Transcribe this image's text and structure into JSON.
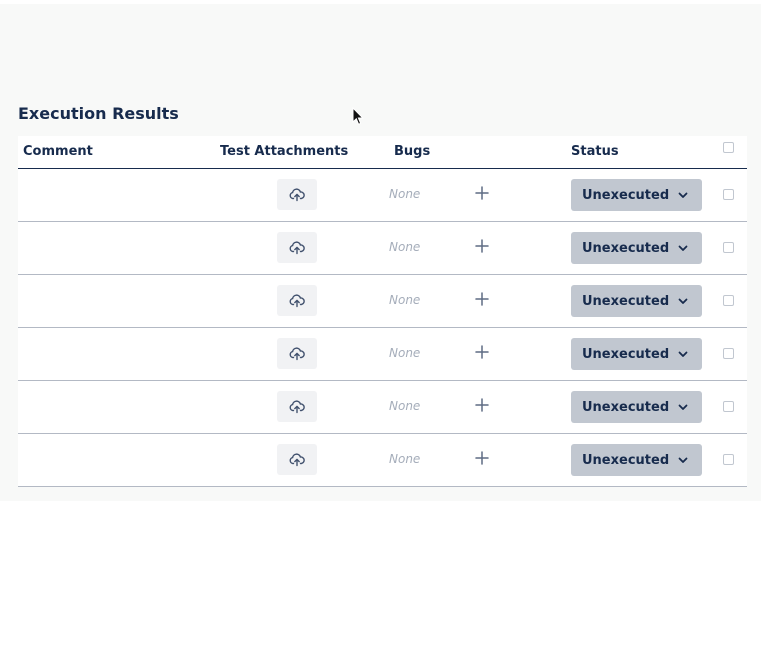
{
  "section": {
    "title": "Execution Results"
  },
  "table": {
    "headers": {
      "comment": "Comment",
      "attachments": "Test Attachments",
      "bugs": "Bugs",
      "status": "Status"
    },
    "rows": [
      {
        "bugs": "None",
        "status": "Unexecuted"
      },
      {
        "bugs": "None",
        "status": "Unexecuted"
      },
      {
        "bugs": "None",
        "status": "Unexecuted"
      },
      {
        "bugs": "None",
        "status": "Unexecuted"
      },
      {
        "bugs": "None",
        "status": "Unexecuted"
      },
      {
        "bugs": "None",
        "status": "Unexecuted"
      }
    ]
  },
  "icons": {
    "upload": "cloud-upload-icon",
    "add": "plus-icon",
    "dropdown": "chevron-down-icon",
    "cursor": "mouse-pointer-icon"
  },
  "colors": {
    "text": "#172b4d",
    "status_button": "#c1c7d0",
    "upload_button": "#f1f2f4",
    "muted": "#a5adba"
  }
}
